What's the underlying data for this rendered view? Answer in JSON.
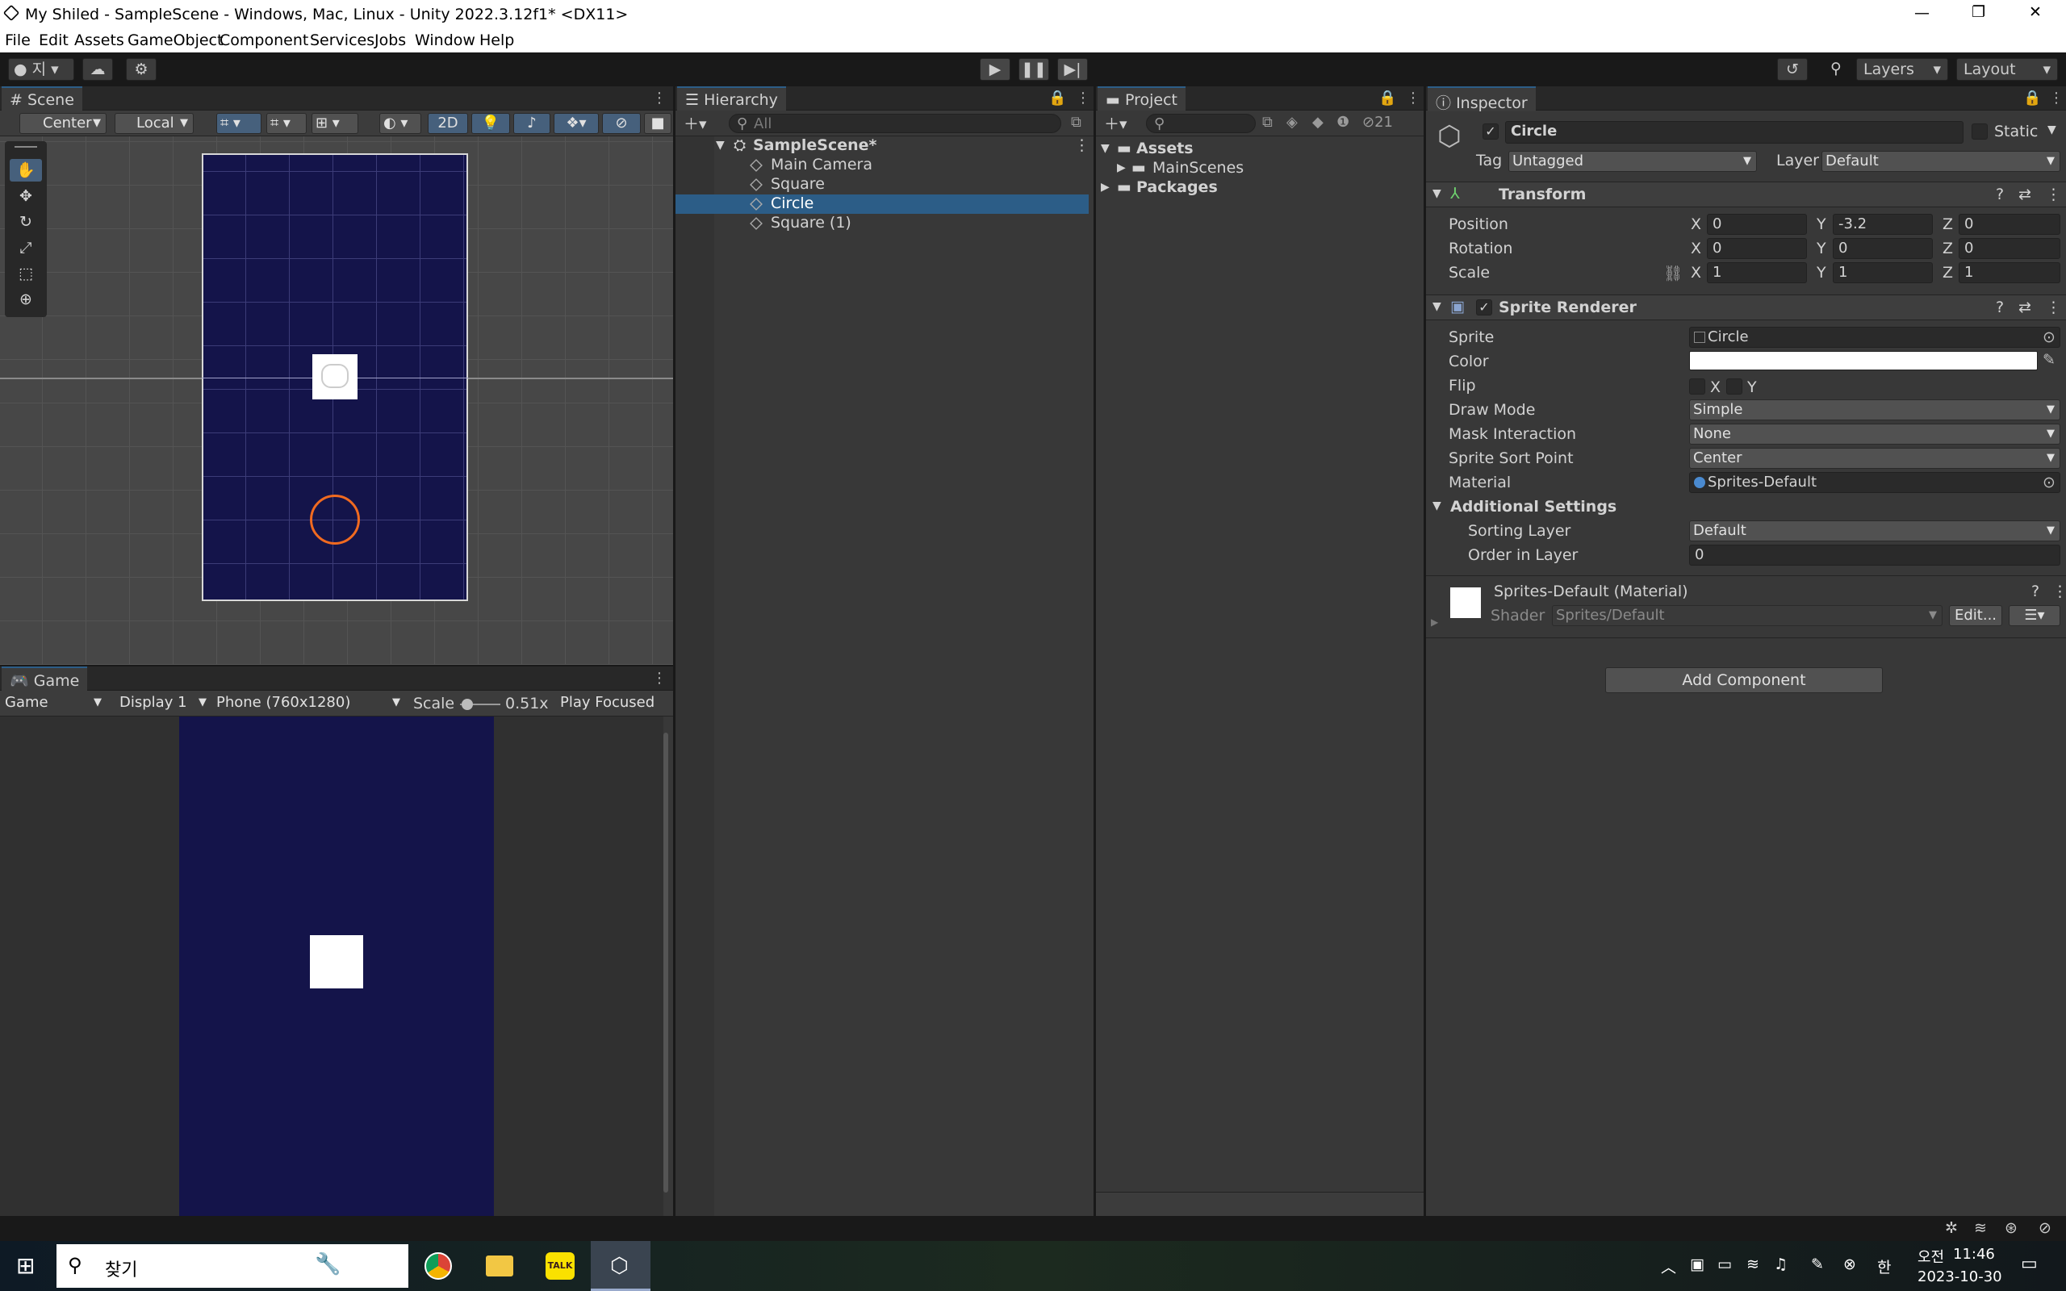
{
  "window": {
    "title": "My Shiled - SampleScene - Windows, Mac, Linux - Unity 2022.3.12f1* <DX11>",
    "minimize": "—",
    "maximize": "❐",
    "close": "✕"
  },
  "menu": [
    "File",
    "Edit",
    "Assets",
    "GameObject",
    "Component",
    "Services",
    "Jobs",
    "Window",
    "Help"
  ],
  "toolbar": {
    "account": "지",
    "layers": "Layers",
    "layout": "Layout"
  },
  "scene": {
    "tab": "Scene",
    "pivot": "Center",
    "space": "Local",
    "mode2d": "2D"
  },
  "game": {
    "tab": "Game",
    "view": "Game",
    "display": "Display 1",
    "resolution": "Phone (760x1280)",
    "scale_label": "Scale",
    "scale_value": "0.51x",
    "play_mode": "Play Focused"
  },
  "hierarchy": {
    "tab": "Hierarchy",
    "search_placeholder": "All",
    "scene": "SampleScene*",
    "items": [
      "Main Camera",
      "Square",
      "Circle",
      "Square (1)"
    ],
    "selected": "Circle"
  },
  "project": {
    "tab": "Project",
    "assets": "Assets",
    "mainscenes": "MainScenes",
    "packages": "Packages",
    "hidden_count": "21"
  },
  "inspector": {
    "tab": "Inspector",
    "name": "Circle",
    "static": "Static",
    "tag_label": "Tag",
    "tag": "Untagged",
    "layer_label": "Layer",
    "layer": "Default",
    "transform": {
      "title": "Transform",
      "position_label": "Position",
      "px": "0",
      "py": "-3.2",
      "pz": "0",
      "rotation_label": "Rotation",
      "rx": "0",
      "ry": "0",
      "rz": "0",
      "scale_label": "Scale",
      "sx": "1",
      "sy": "1",
      "sz": "1"
    },
    "sprite_renderer": {
      "title": "Sprite Renderer",
      "sprite_label": "Sprite",
      "sprite": "Circle",
      "color_label": "Color",
      "flip_label": "Flip",
      "flip_x": "X",
      "flip_y": "Y",
      "draw_mode_label": "Draw Mode",
      "draw_mode": "Simple",
      "mask_label": "Mask Interaction",
      "mask": "None",
      "sort_point_label": "Sprite Sort Point",
      "sort_point": "Center",
      "material_label": "Material",
      "material": "Sprites-Default",
      "additional": "Additional Settings",
      "sorting_layer_label": "Sorting Layer",
      "sorting_layer": "Default",
      "order_label": "Order in Layer",
      "order": "0"
    },
    "material": {
      "title": "Sprites-Default (Material)",
      "shader_label": "Shader",
      "shader": "Sprites/Default",
      "edit": "Edit..."
    },
    "add_component": "Add Component",
    "axis_x": "X",
    "axis_y": "Y",
    "axis_z": "Z"
  },
  "taskbar": {
    "search": "찾기",
    "talk": "TALK",
    "ampm": "오전",
    "time": "11:46",
    "date": "2023-10-30",
    "ime": "한"
  }
}
